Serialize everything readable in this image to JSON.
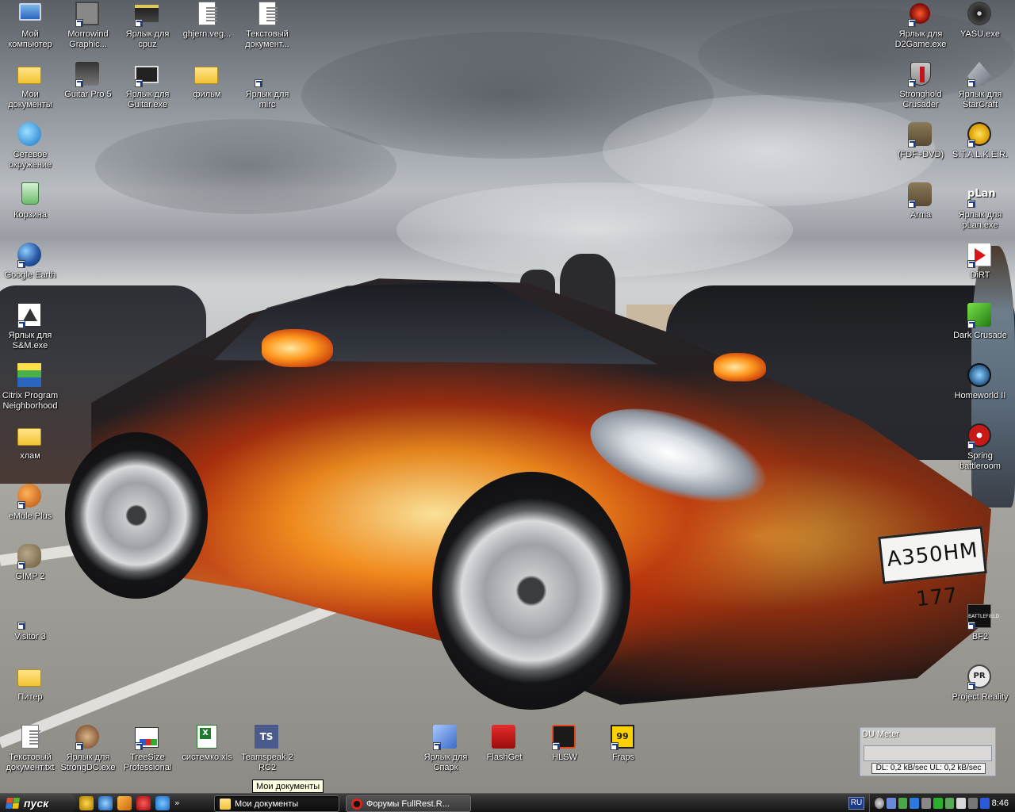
{
  "wallpaper": {
    "plate_text": "А350НМ 177",
    "description_icon": "sports-car-wallpaper"
  },
  "desktop": {
    "left_column": [
      {
        "name": "my-computer-icon",
        "label": "Мой\nкомпьютер",
        "glyph": "computer",
        "shortcut": false
      },
      {
        "name": "my-documents-icon",
        "label": "Мои\nдокументы",
        "glyph": "folder",
        "shortcut": false
      },
      {
        "name": "network-places-icon",
        "label": "Сетевое\nокружение",
        "glyph": "net",
        "shortcut": false
      },
      {
        "name": "recycle-bin-icon",
        "label": "Корзина",
        "glyph": "bin",
        "shortcut": false
      },
      {
        "name": "google-earth-icon",
        "label": "Google Earth",
        "glyph": "earth",
        "shortcut": true
      },
      {
        "name": "sm-exe-icon",
        "label": "Ярлык для\nS&M.exe",
        "glyph": "sm",
        "shortcut": true
      },
      {
        "name": "citrix-icon",
        "label": "Citrix Program\nNeighborhood",
        "glyph": "citrix",
        "shortcut": false
      },
      {
        "name": "hlam-folder-icon",
        "label": "хлам",
        "glyph": "folder",
        "shortcut": false
      },
      {
        "name": "emule-icon",
        "label": "eMule Plus",
        "glyph": "emule",
        "shortcut": true
      },
      {
        "name": "gimp-icon",
        "label": "GIMP 2",
        "glyph": "gimp",
        "shortcut": true
      },
      {
        "name": "visitor-icon",
        "label": "Visitor 3",
        "glyph": "visitor",
        "shortcut": true
      },
      {
        "name": "piter-folder-icon",
        "label": "Питер",
        "glyph": "folder",
        "shortcut": false
      },
      {
        "name": "text-document-icon",
        "label": "Текстовый\nдокумент.txt",
        "glyph": "doc",
        "shortcut": false
      }
    ],
    "top_row": [
      {
        "name": "morrowind-icon",
        "label": "Morrowind\nGraphic...",
        "glyph": "morrowind",
        "shortcut": true
      },
      {
        "name": "cpuz-icon",
        "label": "Ярлык для\ncpuz",
        "glyph": "cpuz",
        "shortcut": true
      },
      {
        "name": "ghjern-icon",
        "label": "ghjern.veg...",
        "glyph": "doc",
        "shortcut": false
      },
      {
        "name": "text-doc-top-icon",
        "label": "Текстовый\nдокумент...",
        "glyph": "doc",
        "shortcut": false
      }
    ],
    "second_row": [
      {
        "name": "guitar-pro-icon",
        "label": "Guitar Pro 5",
        "glyph": "guitar",
        "shortcut": true
      },
      {
        "name": "guitar-exe-icon",
        "label": "Ярлык для\nGuitar.exe",
        "glyph": "chip",
        "shortcut": true
      },
      {
        "name": "film-folder-icon",
        "label": "фильм",
        "glyph": "folder",
        "shortcut": false
      },
      {
        "name": "mirc-icon",
        "label": "Ярлык для\nmirc",
        "glyph": "mirc",
        "shortcut": true
      }
    ],
    "right_column_a": [
      {
        "name": "d2game-icon",
        "label": "Ярлык для\nD2Game.exe",
        "glyph": "d2",
        "shortcut": true
      },
      {
        "name": "stronghold-icon",
        "label": "Stronghold\nCrusader",
        "glyph": "shield",
        "shortcut": true
      },
      {
        "name": "fdf-dvd-icon",
        "label": "(FDF+DVD)",
        "glyph": "soldier",
        "shortcut": true
      },
      {
        "name": "arma-icon",
        "label": "Arma",
        "glyph": "soldier",
        "shortcut": true
      }
    ],
    "right_column_b": [
      {
        "name": "yasu-icon",
        "label": "YASU.exe",
        "glyph": "disc",
        "shortcut": false
      },
      {
        "name": "starcraft-icon",
        "label": "Ярлык для\nStarCraft",
        "glyph": "starcraft",
        "shortcut": true
      },
      {
        "name": "stalker-icon",
        "label": "S.T.A.L.K.E.R.",
        "glyph": "gold",
        "shortcut": true
      },
      {
        "name": "plan-icon",
        "label": "Ярлык для\npLan.exe",
        "glyph": "plan",
        "glyph_text": "pLan",
        "shortcut": true
      },
      {
        "name": "dirt-icon",
        "label": "DiRT",
        "glyph": "dirt",
        "shortcut": true
      },
      {
        "name": "dark-crusade-icon",
        "label": "Dark Crusade",
        "glyph": "green",
        "shortcut": true
      },
      {
        "name": "homeworld-icon",
        "label": "Homeworld II",
        "glyph": "homeworld",
        "shortcut": false
      },
      {
        "name": "spring-icon",
        "label": "Spring\nbattleroom",
        "glyph": "spring",
        "shortcut": true
      },
      {
        "name": "bf2-icon",
        "label": "BF2",
        "glyph": "bf2",
        "glyph_text": "BATTLEFIELD",
        "shortcut": true
      },
      {
        "name": "project-reality-icon",
        "label": "Project Reality",
        "glyph": "pr",
        "glyph_text": "PR",
        "shortcut": true
      }
    ],
    "bottom_row": [
      {
        "name": "strongdc-icon",
        "label": "Ярлык для\nStrongDC.exe",
        "glyph": "strong",
        "shortcut": true
      },
      {
        "name": "treesize-icon",
        "label": "TreeSize\nProfessional",
        "glyph": "treesize",
        "shortcut": true
      },
      {
        "name": "sistemko-xls-icon",
        "label": "системко.xls",
        "glyph": "excel",
        "shortcut": false
      },
      {
        "name": "teamspeak-icon",
        "label": "Teamspeak 2\nRC2",
        "glyph": "ts",
        "glyph_text": "TS",
        "shortcut": false
      },
      {
        "name": "spark-icon",
        "label": "Ярлык для\nСпарк",
        "glyph": "net2",
        "shortcut": true
      },
      {
        "name": "flashget-icon",
        "label": "FlashGet",
        "glyph": "flash",
        "shortcut": false
      },
      {
        "name": "hlsw-icon",
        "label": "HLSW",
        "glyph": "hlsw",
        "shortcut": true
      },
      {
        "name": "fraps-icon",
        "label": "Fraps",
        "glyph": "fraps",
        "glyph_text": "99",
        "shortcut": true
      }
    ]
  },
  "tooltip": {
    "text": "Мои документы"
  },
  "dumeter": {
    "title": "DU Meter",
    "stats": "DL: 0,2 kB/sec  UL: 0,2 kB/sec"
  },
  "taskbar": {
    "start_label": "пуск",
    "quick_launch_more": "»",
    "tasks": [
      {
        "name": "task-my-documents",
        "label": "Мои документы",
        "active": true,
        "icon": "folder"
      },
      {
        "name": "task-fullrest-forum",
        "label": "Форумы FullRest.R...",
        "active": false,
        "icon": "opera"
      }
    ],
    "language": "RU",
    "clock": "8:46"
  }
}
